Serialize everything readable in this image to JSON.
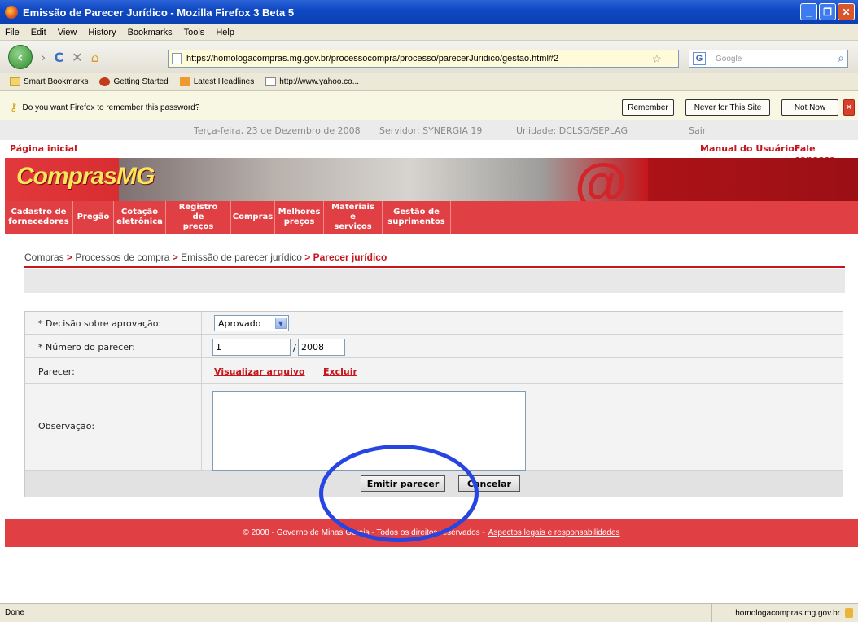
{
  "window": {
    "title": "Emissão de Parecer Jurídico - Mozilla Firefox 3 Beta 5"
  },
  "menu": [
    "File",
    "Edit",
    "View",
    "History",
    "Bookmarks",
    "Tools",
    "Help"
  ],
  "nav": {
    "url": "https://homologacompras.mg.gov.br/processocompra/processo/parecerJuridico/gestao.html#2",
    "search_placeholder": "Google"
  },
  "bookmarks": [
    "Smart Bookmarks",
    "Getting Started",
    "Latest Headlines",
    "http://www.yahoo.co..."
  ],
  "password_bar": {
    "message": "Do you want Firefox to remember this password?",
    "remember": "Remember",
    "never": "Never for This Site",
    "not_now": "Not Now"
  },
  "site": {
    "date": "Terça-feira, 23 de Dezembro de 2008",
    "server": "Servidor: SYNERGIA 19",
    "unit": "Unidade: DCLSG/SEPLAG",
    "exit": "Sair",
    "home": "Página inicial",
    "manual": "Manual do Usuário",
    "contact": "Fale conosco",
    "logo": "ComprasMG"
  },
  "main_nav": [
    {
      "line1": "Cadastro de",
      "line2": "fornecedores"
    },
    {
      "line1": "Pregão",
      "line2": ""
    },
    {
      "line1": "Cotação",
      "line2": "eletrônica"
    },
    {
      "line1": "Registro de",
      "line2": "preços"
    },
    {
      "line1": "Compras",
      "line2": ""
    },
    {
      "line1": "Melhores",
      "line2": "preços"
    },
    {
      "line1": "Materiais e",
      "line2": "serviços"
    },
    {
      "line1": "Gestão de",
      "line2": "suprimentos"
    }
  ],
  "breadcrumb": {
    "c1": "Compras",
    "c2": "Processos de compra",
    "c3": "Emissão de parecer jurídico",
    "current": "Parecer jurídico",
    "sep": ">"
  },
  "form": {
    "decision_label": "* Decisão sobre aprovação:",
    "decision_value": "Aprovado",
    "number_label": "* Número do parecer:",
    "number_value": "1",
    "slash": "/",
    "year_value": "2008",
    "parecer_label": "Parecer:",
    "view_link": "Visualizar arquivo",
    "delete_link": "Excluir",
    "obs_label": "Observação:",
    "submit": "Emitir parecer",
    "cancel": "Cancelar"
  },
  "footer": {
    "text": "© 2008 - Governo de Minas Gerais - Todos os direitos reservados -",
    "link": "Aspectos legais e responsabilidades"
  },
  "status": {
    "left": "Done",
    "right": "homologacompras.mg.gov.br"
  }
}
